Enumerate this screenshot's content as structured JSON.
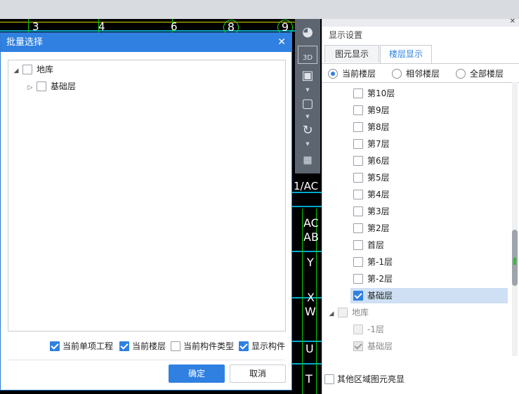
{
  "cad": {
    "axis_top": [
      "3",
      "4",
      "6",
      "8",
      "9"
    ],
    "axis_side": [
      "1/AC",
      "AC",
      "AB",
      "Y",
      "X",
      "W",
      "U",
      "T"
    ]
  },
  "dialog": {
    "title": "批量选择",
    "tree": [
      {
        "label": "地库",
        "checked": false,
        "expanded": true
      },
      {
        "label": "基础层",
        "checked": false,
        "expanded": false
      }
    ],
    "options": [
      {
        "label": "当前单项工程",
        "checked": true
      },
      {
        "label": "当前楼层",
        "checked": true
      },
      {
        "label": "当前构件类型",
        "checked": false
      },
      {
        "label": "显示构件",
        "checked": true
      }
    ],
    "ok_label": "确定",
    "cancel_label": "取消"
  },
  "panel": {
    "title": "显示设置",
    "tabs": [
      "图元显示",
      "楼层显示"
    ],
    "active_tab": "楼层显示",
    "radios": [
      {
        "label": "当前楼层",
        "selected": true
      },
      {
        "label": "相邻楼层",
        "selected": false
      },
      {
        "label": "全部楼层",
        "selected": false
      }
    ],
    "floors": [
      {
        "label": "第10层",
        "checked": false
      },
      {
        "label": "第9层",
        "checked": false
      },
      {
        "label": "第8层",
        "checked": false
      },
      {
        "label": "第7层",
        "checked": false
      },
      {
        "label": "第6层",
        "checked": false
      },
      {
        "label": "第5层",
        "checked": false
      },
      {
        "label": "第4层",
        "checked": false
      },
      {
        "label": "第3层",
        "checked": false
      },
      {
        "label": "第2层",
        "checked": false
      },
      {
        "label": "首层",
        "checked": false
      },
      {
        "label": "第-1层",
        "checked": false
      },
      {
        "label": "第-2层",
        "checked": false
      },
      {
        "label": "基础层",
        "checked": true,
        "selected": true
      }
    ],
    "group2": {
      "label": "地库",
      "children": [
        {
          "label": "-1层",
          "checked": false
        },
        {
          "label": "基础层",
          "checked": true
        }
      ]
    },
    "bottom_option": "其他区域图元亮显",
    "accent": "#2f80e0"
  }
}
